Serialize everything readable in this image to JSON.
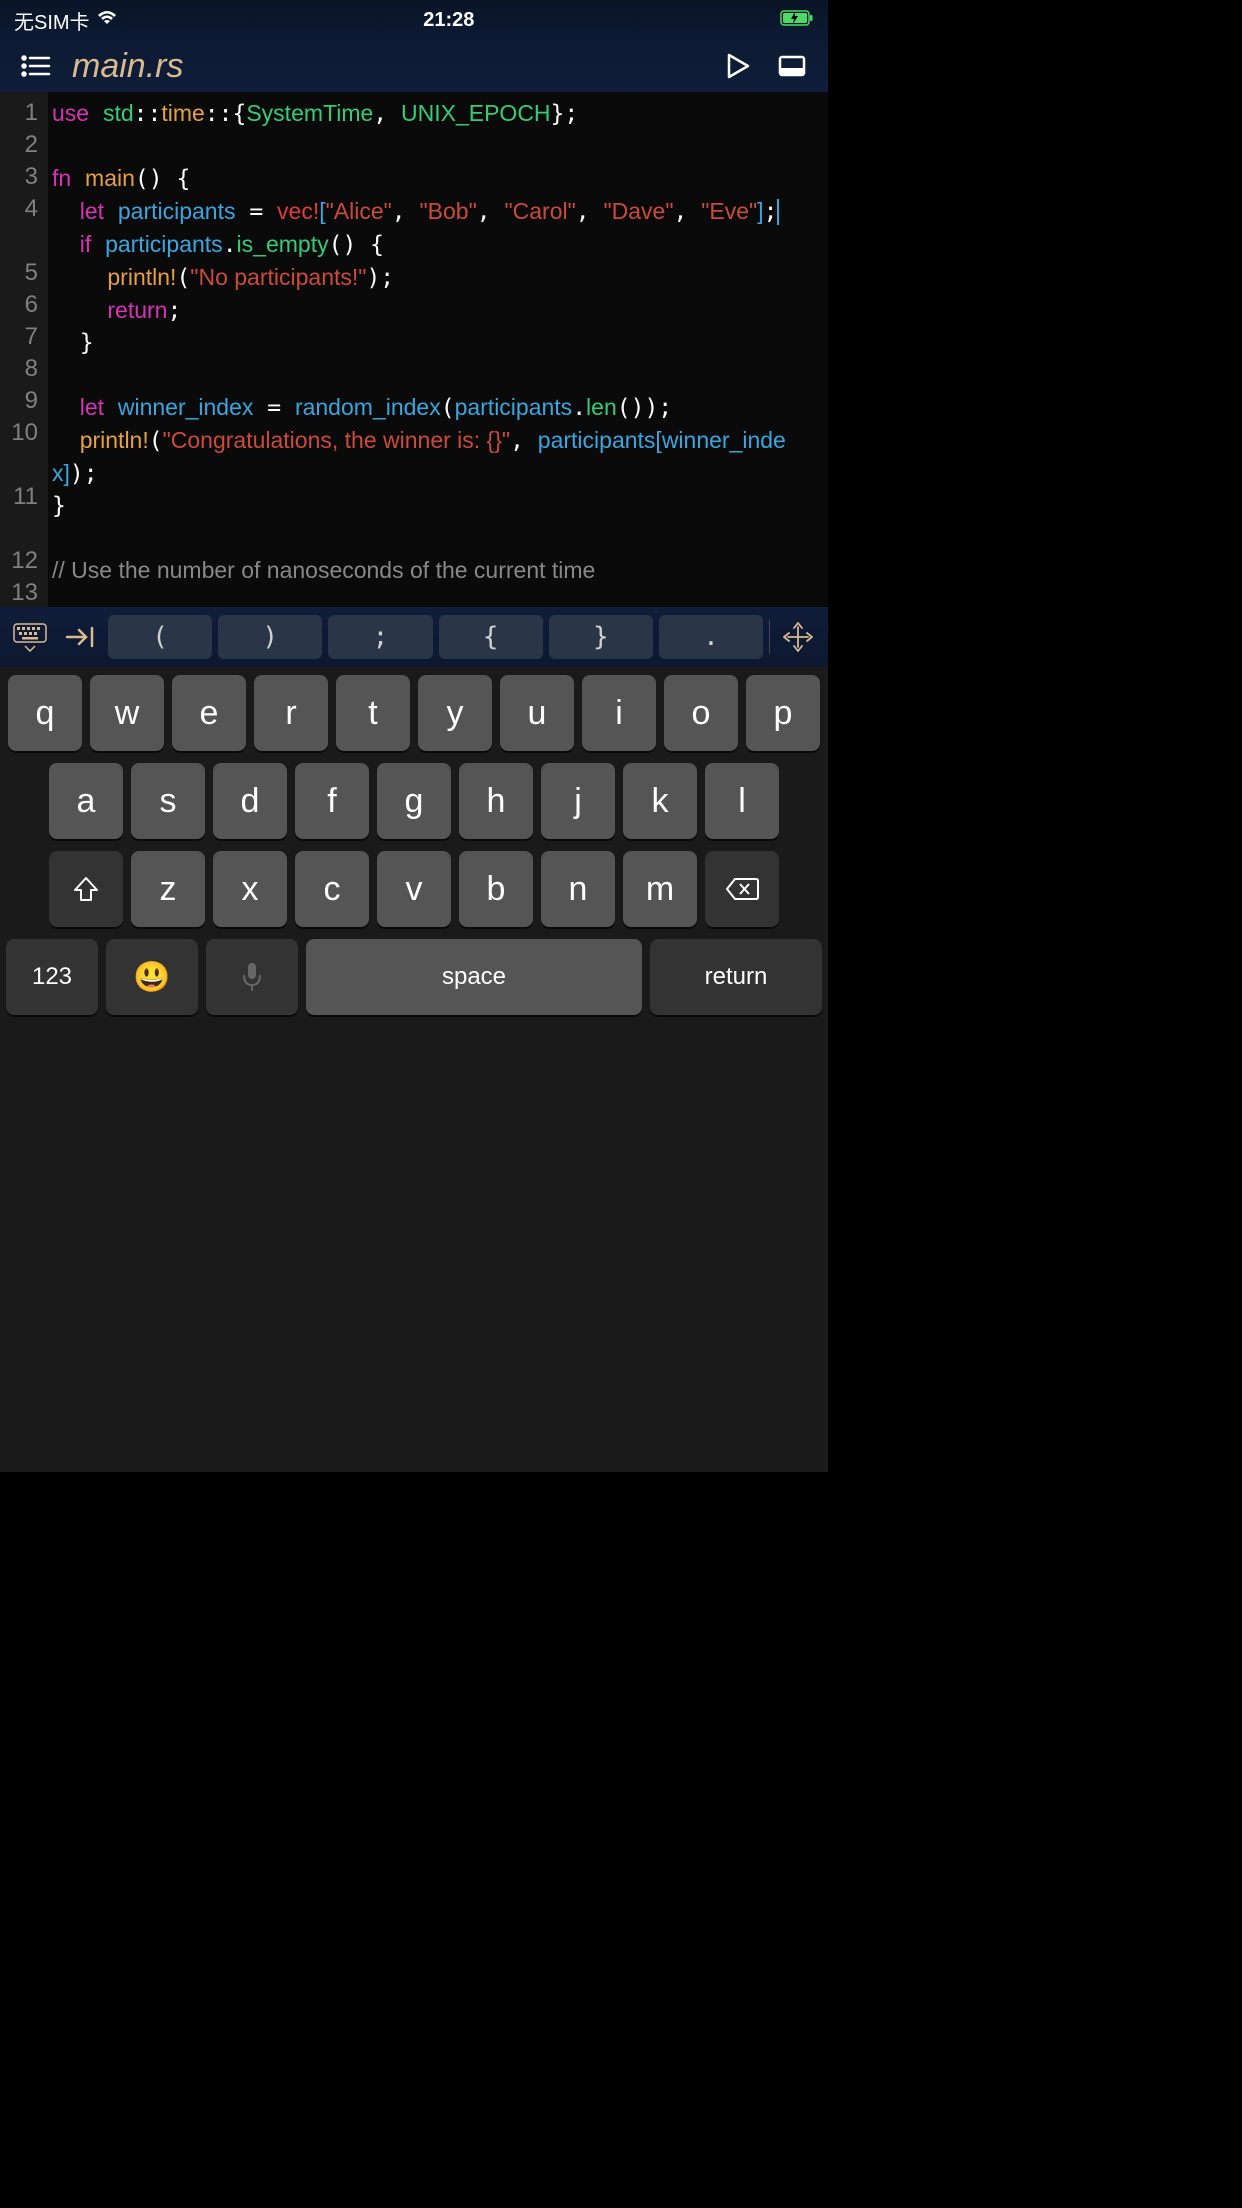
{
  "status": {
    "left": "无SIM卡",
    "time": "21:28"
  },
  "toolbar": {
    "filename": "main.rs"
  },
  "gutter": [
    "1",
    "2",
    "3",
    "4",
    "",
    "5",
    "6",
    "7",
    "8",
    "9",
    "10",
    "",
    "11",
    "",
    "12",
    "13",
    ""
  ],
  "code": {
    "l1": {
      "use": "use",
      "std": "std",
      "time": "time",
      "st": "SystemTime",
      "ux": "UNIX_EPOCH"
    },
    "l3": {
      "fn": "fn",
      "main": "main"
    },
    "l4": {
      "let": "let",
      "part": "participants",
      "vec": "vec!",
      "alice": "\"Alice\"",
      "bob": "\"Bob\"",
      "carol": "\"Carol\"",
      "dave": "\"Dave\"",
      "eve": "\"Eve\""
    },
    "l5": {
      "if": "if",
      "part": "participants",
      "emp": "is_empty"
    },
    "l6": {
      "pr": "println!",
      "msg": "\"No participants!\""
    },
    "l7": {
      "ret": "return"
    },
    "l10": {
      "let": "let",
      "wi": "winner_index",
      "ri": "random_index",
      "part": "participants",
      "len": "len"
    },
    "l11": {
      "pr": "println!",
      "msg": "\"Congratulations, the winner is: {}\"",
      "part": "participants",
      "wi": "winner_index"
    },
    "l14": "// Use the number of nanoseconds of the current time"
  },
  "symbols": [
    "(",
    ")",
    ";",
    "{",
    "}",
    "."
  ],
  "keyboard": {
    "row1": [
      "q",
      "w",
      "e",
      "r",
      "t",
      "y",
      "u",
      "i",
      "o",
      "p"
    ],
    "row2": [
      "a",
      "s",
      "d",
      "f",
      "g",
      "h",
      "j",
      "k",
      "l"
    ],
    "row3": [
      "z",
      "x",
      "c",
      "v",
      "b",
      "n",
      "m"
    ],
    "num": "123",
    "space": "space",
    "return": "return"
  }
}
